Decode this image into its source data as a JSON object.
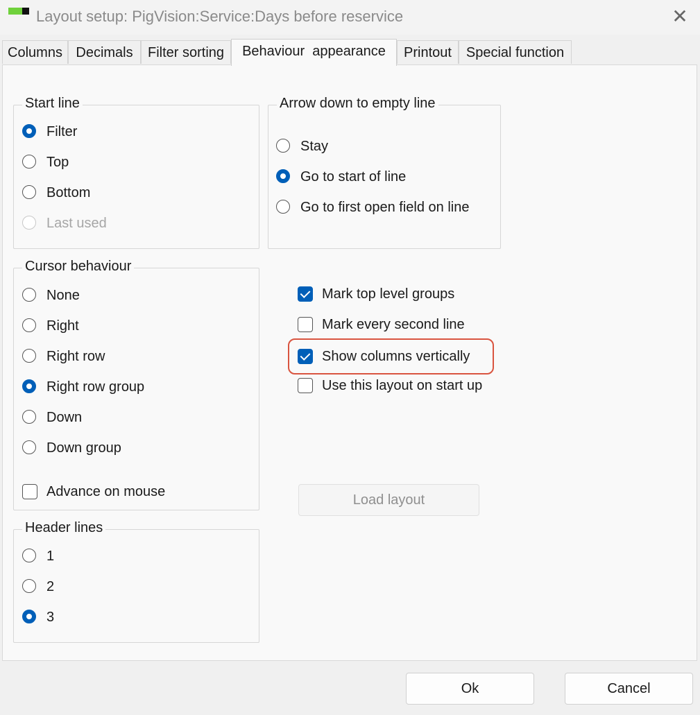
{
  "window": {
    "title": "Layout setup: PigVision:Service:Days before reservice",
    "close_glyph": "✕"
  },
  "tabs": [
    {
      "label": "Columns",
      "active": false
    },
    {
      "label": "Decimals",
      "active": false
    },
    {
      "label": "Filter sorting",
      "active": false
    },
    {
      "label": "Behaviour  appearance",
      "active": true
    },
    {
      "label": "Printout",
      "active": false
    },
    {
      "label": "Special function",
      "active": false
    }
  ],
  "start_line": {
    "title": "Start line",
    "options": [
      {
        "label": "Filter",
        "selected": true,
        "enabled": true
      },
      {
        "label": "Top",
        "selected": false,
        "enabled": true
      },
      {
        "label": "Bottom",
        "selected": false,
        "enabled": true
      },
      {
        "label": "Last used",
        "selected": false,
        "enabled": false
      }
    ]
  },
  "arrow_down": {
    "title": "Arrow down to empty line",
    "options": [
      {
        "label": "Stay",
        "selected": false
      },
      {
        "label": "Go to start of line",
        "selected": true
      },
      {
        "label": "Go to first open field on line",
        "selected": false
      }
    ]
  },
  "cursor_behaviour": {
    "title": "Cursor behaviour",
    "options": [
      {
        "label": "None",
        "selected": false
      },
      {
        "label": "Right",
        "selected": false
      },
      {
        "label": "Right row",
        "selected": false
      },
      {
        "label": "Right row group",
        "selected": true
      },
      {
        "label": "Down",
        "selected": false
      },
      {
        "label": "Down group",
        "selected": false
      }
    ],
    "advance_on_mouse": {
      "label": "Advance on mouse",
      "checked": false
    }
  },
  "checkboxes": [
    {
      "label": "Mark top level groups",
      "checked": true
    },
    {
      "label": "Mark every second line",
      "checked": false
    },
    {
      "label": "Show columns vertically",
      "checked": true
    },
    {
      "label": "Use this layout on start up",
      "checked": false
    }
  ],
  "header_lines": {
    "title": "Header lines",
    "options": [
      {
        "label": "1",
        "selected": false
      },
      {
        "label": "2",
        "selected": false
      },
      {
        "label": "3",
        "selected": true
      }
    ]
  },
  "buttons": {
    "load_layout": "Load layout",
    "ok": "Ok",
    "cancel": "Cancel"
  },
  "colors": {
    "accent": "#005fb8",
    "highlight": "#d9543f",
    "app_icon": "#6fd13b"
  }
}
